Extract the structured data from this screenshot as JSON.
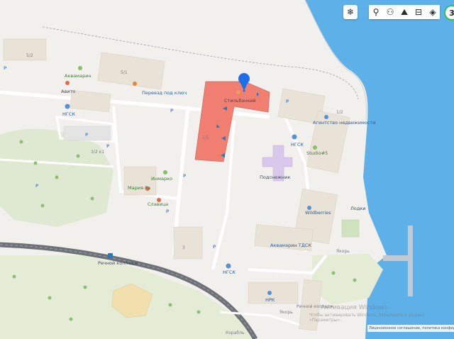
{
  "colors": {
    "water": "#5db0e8",
    "land": "#f2f0ec",
    "highlight_building": "#f07f72",
    "pin": "#1f6fe8",
    "green": "#dfe8d0"
  },
  "toolbar": {
    "weather_icon": "snowflake-icon",
    "buttons": [
      "pin-icon",
      "people-icon",
      "mountains-icon",
      "bus-icon",
      "layers-icon"
    ],
    "zoom_label": "3"
  },
  "labels": {
    "akvamarin": "Аквамарин",
    "avito": "Авито",
    "pereezd": "Переезд под ключ",
    "ngsk1": "НГСК",
    "selected": "Стильбэнкий",
    "agentstvo": "Агентство недвижимости",
    "ngsk2": "НГСК",
    "studio5": "Studio#5",
    "podsnezhnik": "Подснежник",
    "inmarko": "Инмарко",
    "mariya": "Мария-Ра",
    "slavitsa": "Славица",
    "wildberries": "Wildberries",
    "lodki": "Лодки",
    "akvamarin_tdsk": "Аквамарин ТДСК",
    "yakor1": "Якорь",
    "rechnoy_kolledzh": "Речной колледж",
    "ngsk3": "НГСК",
    "nrk": "НРК",
    "rechnoy_kolledzh2": "Речной колледж",
    "yakor2": "Якорь",
    "korabl": "Корабль"
  },
  "numbers": {
    "h52": "5/2",
    "h51": "5/1",
    "h12": "1/2",
    "h31": "3/2 к1",
    "h3": "3",
    "h15": "1/5"
  },
  "watermark": {
    "line1": "Активация Windows",
    "line2": "Чтобы активировать Windows, перейдите в раздел «Параметры»."
  },
  "copyright": "Лицензионное соглашение, политика конфиденциальности"
}
